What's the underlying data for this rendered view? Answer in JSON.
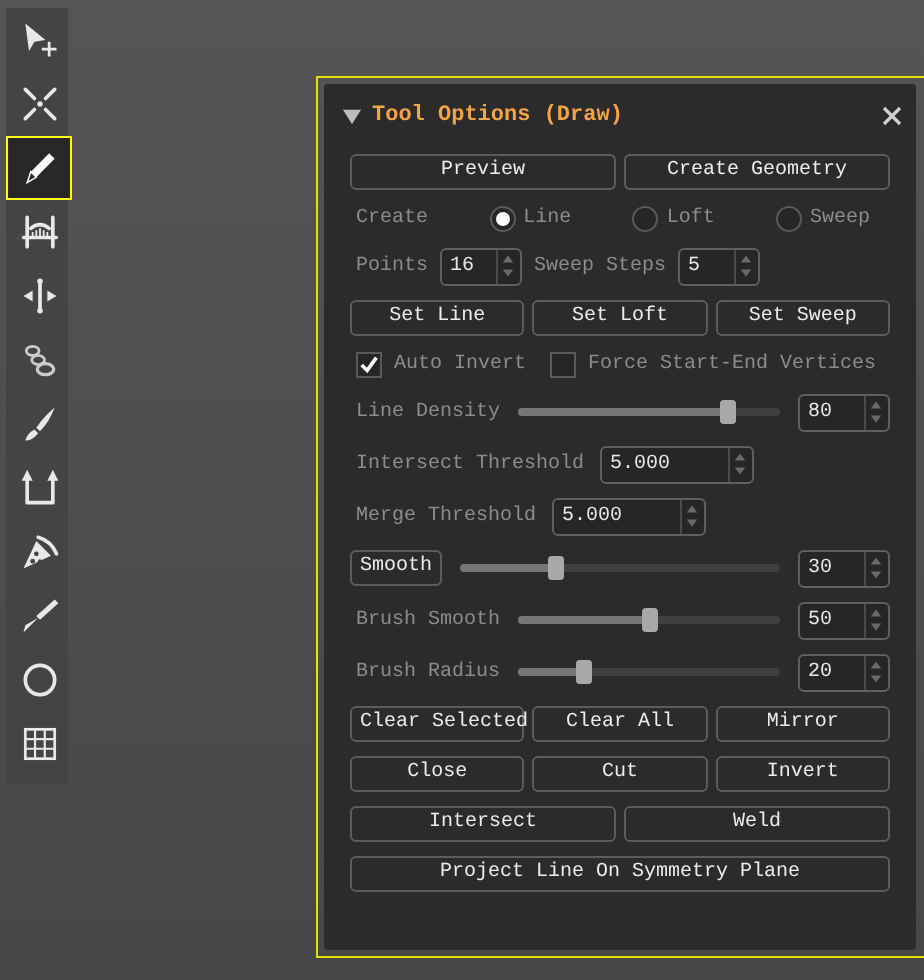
{
  "toolbar": {
    "tools": [
      {
        "selected": false
      },
      {
        "selected": false
      },
      {
        "selected": true
      },
      {
        "selected": false
      },
      {
        "selected": false
      },
      {
        "selected": false
      },
      {
        "selected": false
      },
      {
        "selected": false
      },
      {
        "selected": false
      },
      {
        "selected": false
      },
      {
        "selected": false
      },
      {
        "selected": false
      }
    ]
  },
  "panel": {
    "title": "Tool Options (Draw)",
    "expanded": true,
    "rows": [
      {
        "kind": "buttons",
        "buttons": [
          "Preview",
          "Create Geometry"
        ]
      },
      {
        "kind": "radio",
        "label": "Create",
        "options": [
          {
            "label": "Line",
            "selected": true
          },
          {
            "label": "Loft",
            "selected": false
          },
          {
            "label": "Sweep",
            "selected": false
          }
        ]
      },
      {
        "kind": "spinners",
        "fields": [
          {
            "label": "Points",
            "value": "16"
          },
          {
            "label": "Sweep Steps",
            "value": "5"
          }
        ]
      },
      {
        "kind": "buttons",
        "buttons": [
          "Set Line",
          "Set Loft",
          "Set Sweep"
        ]
      },
      {
        "kind": "checkboxes",
        "options": [
          {
            "label": "Auto Invert",
            "checked": true
          },
          {
            "label": "Force Start-End Vertices",
            "checked": false
          }
        ]
      },
      {
        "kind": "slider",
        "label": "Line Density",
        "label_is_button": false,
        "level": 0.8,
        "value": "80"
      },
      {
        "kind": "spinner",
        "label": "Intersect Threshold",
        "value": "5.000"
      },
      {
        "kind": "spinner",
        "label": "Merge Threshold",
        "value": "5.000"
      },
      {
        "kind": "slider",
        "label": "Smooth",
        "label_is_button": true,
        "level": 0.3,
        "value": "30"
      },
      {
        "kind": "slider",
        "label": "Brush Smooth",
        "label_is_button": false,
        "level": 0.5,
        "value": "50"
      },
      {
        "kind": "slider",
        "label": "Brush Radius",
        "label_is_button": false,
        "level": 0.25,
        "value": "20"
      },
      {
        "kind": "buttons",
        "buttons": [
          "Clear Selected",
          "Clear All",
          "Mirror"
        ]
      },
      {
        "kind": "buttons",
        "buttons": [
          "Close",
          "Cut",
          "Invert"
        ]
      },
      {
        "kind": "buttons",
        "buttons": [
          "Intersect",
          "Weld"
        ]
      },
      {
        "kind": "buttons",
        "buttons": [
          "Project Line On Symmetry Plane"
        ]
      }
    ]
  }
}
